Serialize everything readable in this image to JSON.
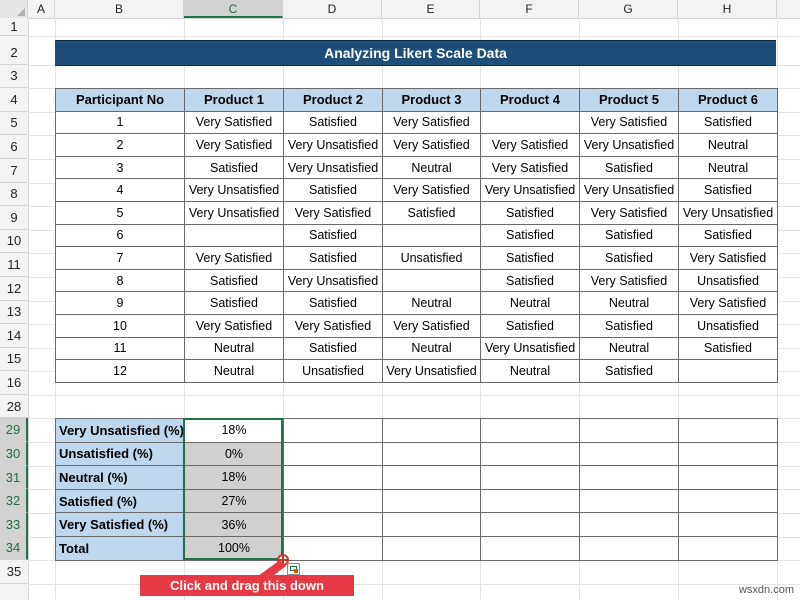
{
  "columns": [
    "A",
    "B",
    "C",
    "D",
    "E",
    "F",
    "G",
    "H"
  ],
  "rows": [
    "1",
    "2",
    "3",
    "4",
    "5",
    "6",
    "7",
    "8",
    "9",
    "10",
    "11",
    "12",
    "13",
    "14",
    "15",
    "16",
    "28",
    "29",
    "30",
    "31",
    "32",
    "33",
    "34",
    "35"
  ],
  "selected_column": "C",
  "selected_rows": [
    "29",
    "30",
    "31",
    "32",
    "33",
    "34"
  ],
  "title": "Analyzing Likert Scale Data",
  "table": {
    "headers": [
      "Participant No",
      "Product 1",
      "Product 2",
      "Product 3",
      "Product 4",
      "Product 5",
      "Product 6"
    ],
    "rows": [
      [
        "1",
        "Very Satisfied",
        "Satisfied",
        "Very Satisfied",
        "",
        "Very Satisfied",
        "Satisfied"
      ],
      [
        "2",
        "Very Satisfied",
        "Very Unsatisfied",
        "Very Satisfied",
        "Very Satisfied",
        "Very Unsatisfied",
        "Neutral"
      ],
      [
        "3",
        "Satisfied",
        "Very Unsatisfied",
        "Neutral",
        "Very Satisfied",
        "Satisfied",
        "Neutral"
      ],
      [
        "4",
        "Very Unsatisfied",
        "Satisfied",
        "Very Satisfied",
        "Very Unsatisfied",
        "Very Unsatisfied",
        "Satisfied"
      ],
      [
        "5",
        "Very Unsatisfied",
        "Very Satisfied",
        "Satisfied",
        "Satisfied",
        "Very Satisfied",
        "Very Unsatisfied"
      ],
      [
        "6",
        "",
        "Satisfied",
        "",
        "Satisfied",
        "Satisfied",
        "Satisfied"
      ],
      [
        "7",
        "Very Satisfied",
        "Satisfied",
        "Unsatisfied",
        "Satisfied",
        "Satisfied",
        "Very Satisfied"
      ],
      [
        "8",
        "Satisfied",
        "Very Unsatisfied",
        "",
        "Satisfied",
        "Very Satisfied",
        "Unsatisfied"
      ],
      [
        "9",
        "Satisfied",
        "Satisfied",
        "Neutral",
        "Neutral",
        "Neutral",
        "Very Satisfied"
      ],
      [
        "10",
        "Very Satisfied",
        "Very Satisfied",
        "Very Satisfied",
        "Satisfied",
        "Satisfied",
        "Unsatisfied"
      ],
      [
        "11",
        "Neutral",
        "Satisfied",
        "Neutral",
        "Very Unsatisfied",
        "Neutral",
        "Satisfied"
      ],
      [
        "12",
        "Neutral",
        "Unsatisfied",
        "Very Unsatisfied",
        "Neutral",
        "Satisfied",
        ""
      ]
    ]
  },
  "summary": {
    "labels": [
      "Very Unsatisfied (%)",
      "Unsatisfied (%)",
      "Neutral (%)",
      "Satisfied (%)",
      "Very Satisfied (%)",
      "Total"
    ],
    "product1_values": [
      "18%",
      "0%",
      "18%",
      "27%",
      "36%",
      "100%"
    ]
  },
  "callout": "Click and drag this down",
  "watermark": "wsxdn.com",
  "colors": {
    "title_bg": "#1f4e79",
    "header_bg": "#bdd7ee",
    "selection": "#217346",
    "callout_bg": "#e63946"
  }
}
